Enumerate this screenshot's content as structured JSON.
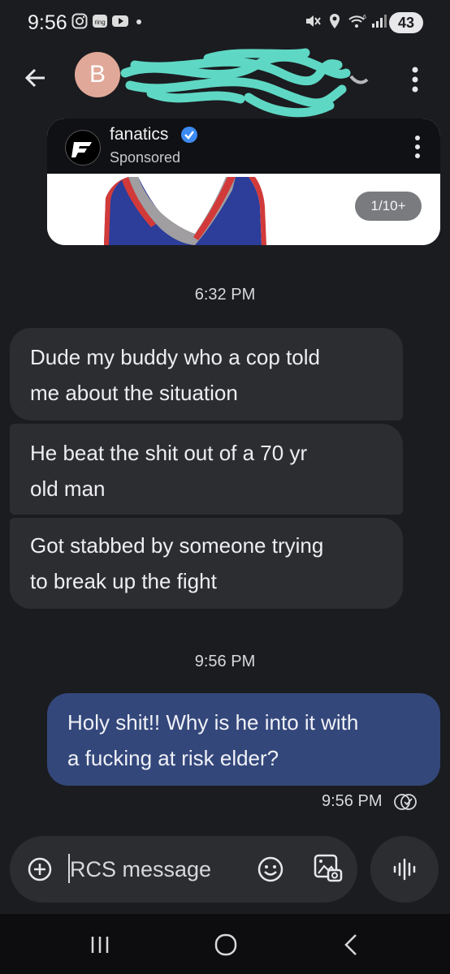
{
  "status_bar": {
    "time": "9:56",
    "icons": [
      "instagram-icon",
      "ring-icon",
      "youtube-icon",
      "dot-icon",
      "mute-icon",
      "location-icon",
      "wifi-icon",
      "signal-icon"
    ],
    "battery": "43"
  },
  "header": {
    "avatar_letter": "B",
    "contact_name": "",
    "icons": [
      "back-arrow-icon",
      "more-vert-icon"
    ]
  },
  "ad": {
    "brand": "fanatics",
    "label": "Sponsored",
    "counter": "1/10+",
    "icons": [
      "fanatics-logo-icon",
      "verified-badge-icon",
      "more-vert-icon",
      "jersey-image"
    ]
  },
  "conversation": {
    "timestamp_1": "6:32 PM",
    "incoming": [
      {
        "line1": "Dude my buddy who a cop told",
        "line2": "me about the situation"
      },
      {
        "line1": "He beat the shit out of a 70 yr",
        "line2": "old man"
      },
      {
        "line1": "Got stabbed by someone trying",
        "line2": "to break up the fight"
      }
    ],
    "timestamp_2": "9:56 PM",
    "outgoing": {
      "line1": "Holy shit!! Why is he into it with",
      "line2": "a fucking at risk elder?"
    },
    "sent_time": "9:56 PM"
  },
  "compose": {
    "placeholder": "RCS message",
    "icons": [
      "add-circle-icon",
      "emoji-icon",
      "gallery-icon",
      "voice-icon"
    ]
  },
  "colors": {
    "background": "#1b1c20",
    "incoming_bubble": "#2c2d31",
    "outgoing_bubble": "#33477a",
    "avatar": "#e0a898",
    "scribble": "#5ed8c4",
    "verified": "#3d8bf2"
  }
}
